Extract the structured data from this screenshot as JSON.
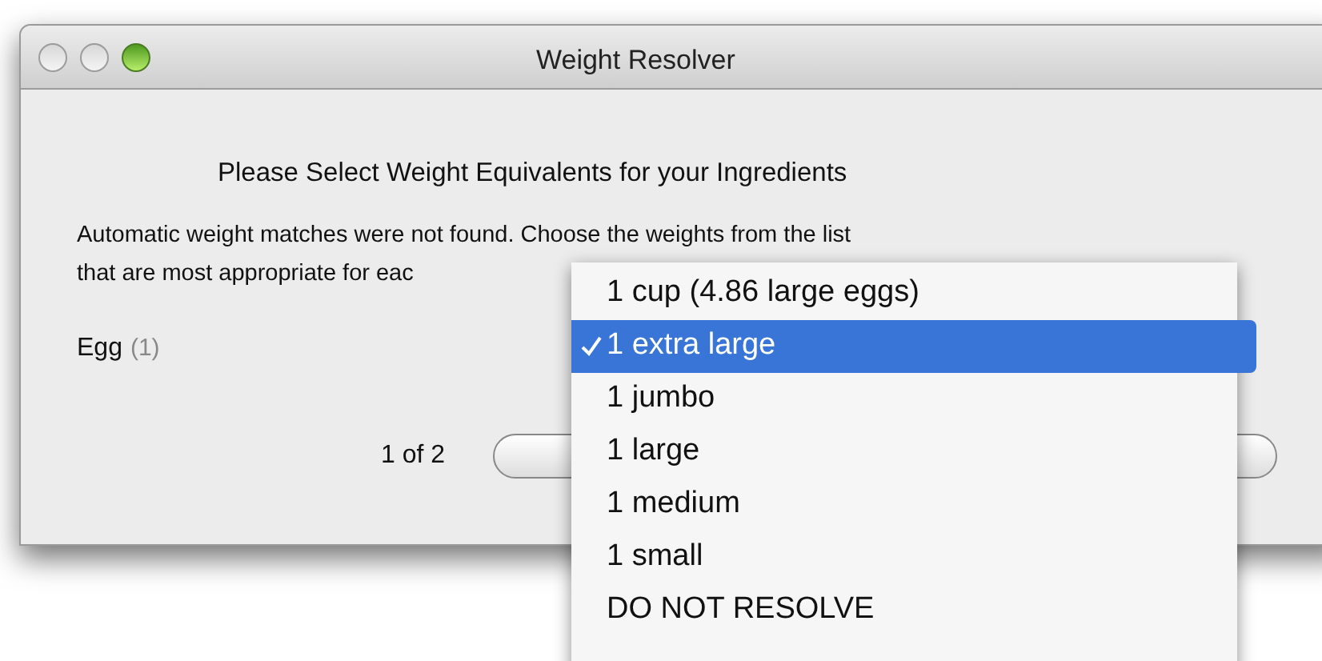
{
  "window": {
    "title": "Weight Resolver"
  },
  "heading": "Please Select Weight Equivalents for your Ingredients",
  "message_lines": [
    "Automatic weight matches were not found. Choose the weights from the list",
    "that are most appropriate for eac"
  ],
  "ingredient": {
    "name": "Egg",
    "count": "(1)"
  },
  "pager": "1 of 2",
  "menu": [
    {
      "label": "1 cup (4.86 large eggs)",
      "selected": false
    },
    {
      "label": "1 extra large",
      "selected": true
    },
    {
      "label": "1 jumbo",
      "selected": false
    },
    {
      "label": "1 large",
      "selected": false
    },
    {
      "label": "1 medium",
      "selected": false
    },
    {
      "label": "1 small",
      "selected": false
    },
    {
      "label": "DO NOT RESOLVE",
      "selected": false
    }
  ]
}
